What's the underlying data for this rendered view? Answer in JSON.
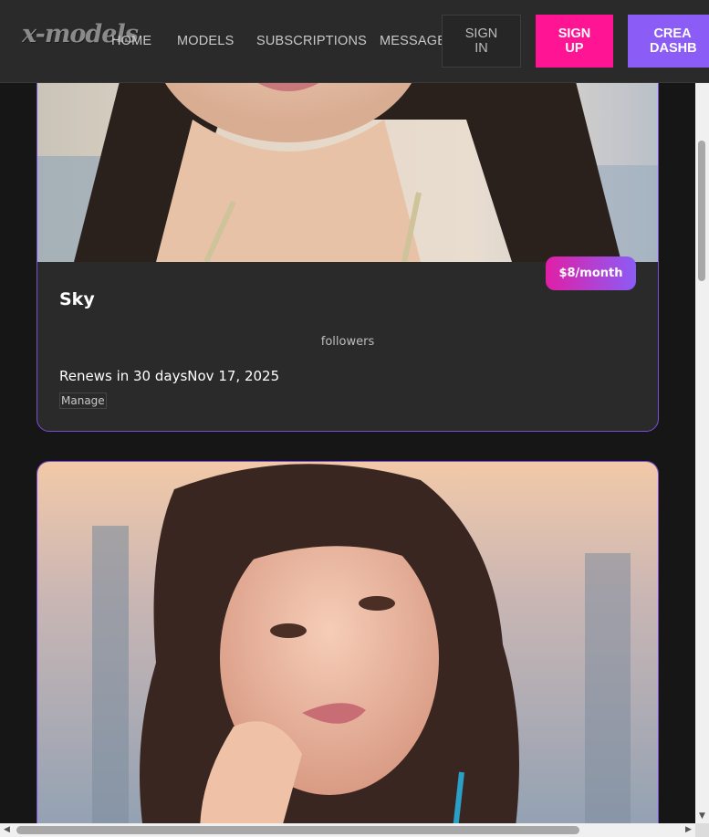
{
  "header": {
    "logo_text": "x-models",
    "nav": {
      "home": "HOME",
      "models": "MODELS",
      "subscriptions": "SUBSCRIPTIONS",
      "messages": "MESSAGES"
    },
    "sign_in_label": "SIGN IN",
    "sign_up_label": "SIGN UP",
    "create_dashboard_label": "CREA DASHB"
  },
  "subscriptions": [
    {
      "name": "Sky",
      "price": "$8/month",
      "followers_label": "followers",
      "renew_text": "Renews in 30 days",
      "renew_date": "Nov 17, 2025",
      "manage_label": "Manage"
    }
  ],
  "colors": {
    "accent_pink": "#ff1493",
    "accent_purple": "#8b5cf6",
    "card_border": "#7c4ddb",
    "background": "#161616"
  }
}
